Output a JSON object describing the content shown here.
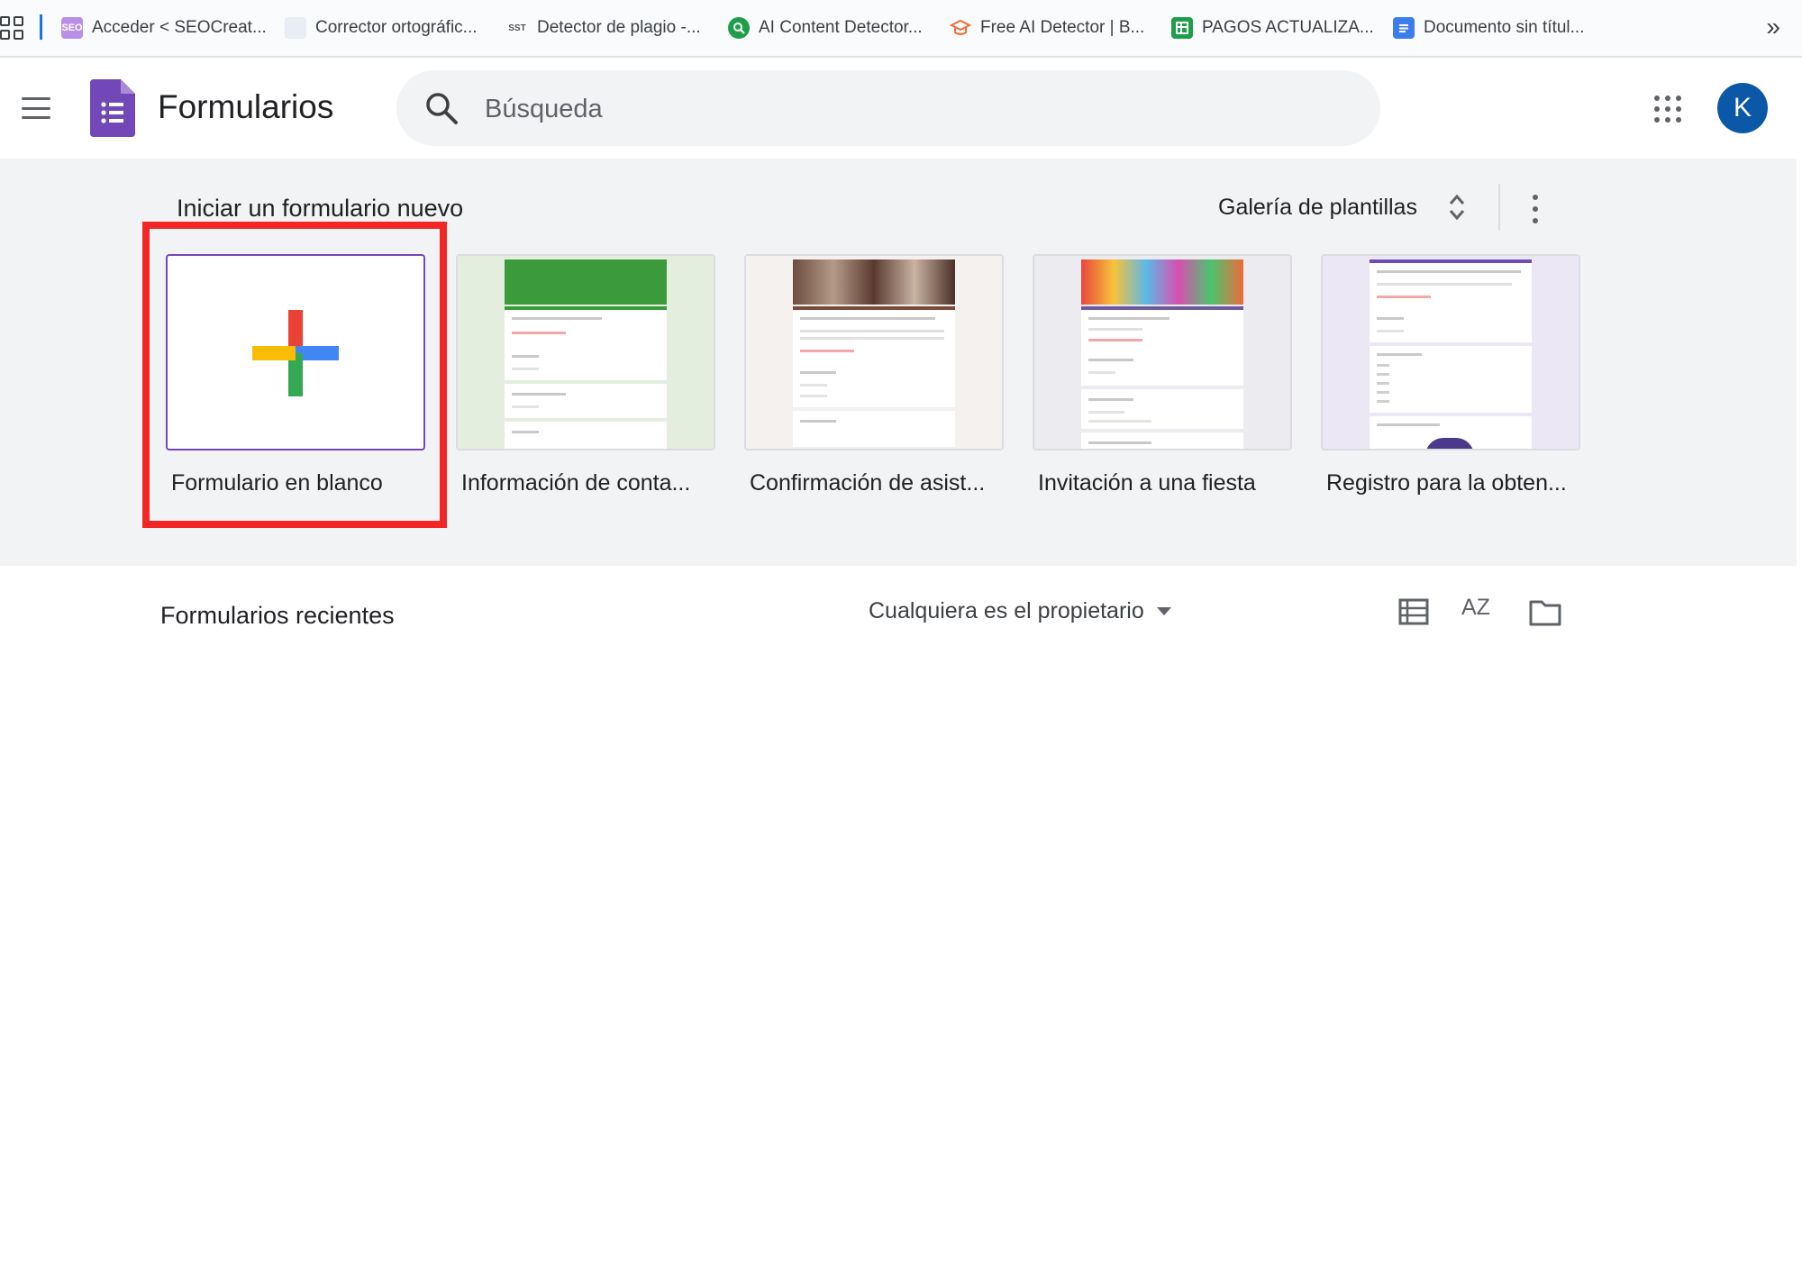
{
  "bookmarks": {
    "items": [
      {
        "label": "Acceder < SEOCreat...",
        "icon": "seo-favicon-icon"
      },
      {
        "label": "Corrector ortográfic...",
        "icon": "corrector-favicon-icon"
      },
      {
        "label": "Detector de plagio -...",
        "icon": "sst-favicon-icon",
        "badge": "SST"
      },
      {
        "label": "AI Content Detector...",
        "icon": "ai-content-favicon-icon"
      },
      {
        "label": "Free AI Detector | B...",
        "icon": "graduation-cap-icon"
      },
      {
        "label": "PAGOS ACTUALIZA...",
        "icon": "sheets-icon"
      },
      {
        "label": "Documento sin títul...",
        "icon": "docs-icon"
      }
    ],
    "more": "»"
  },
  "header": {
    "title": "Formularios",
    "search_placeholder": "Búsqueda",
    "avatar_letter": "K"
  },
  "templates": {
    "section_title": "Iniciar un formulario nuevo",
    "gallery_label": "Galería de plantillas",
    "cards": [
      {
        "label": "Formulario en blanco"
      },
      {
        "label": "Información de conta..."
      },
      {
        "label": "Confirmación de asist..."
      },
      {
        "label": "Invitación a una fiesta"
      },
      {
        "label": "Registro para la obten..."
      }
    ]
  },
  "recent": {
    "title": "Formularios recientes",
    "owner_filter": "Cualquiera es el propietario",
    "sort_label": "AZ"
  },
  "colors": {
    "forms_purple": "#7248b9",
    "highlight_red": "#f32626",
    "avatar_blue": "#0b57a8",
    "plus_red": "#ea4335",
    "plus_blue": "#4285f4",
    "plus_green": "#34a853",
    "plus_yellow": "#fbbc04"
  }
}
